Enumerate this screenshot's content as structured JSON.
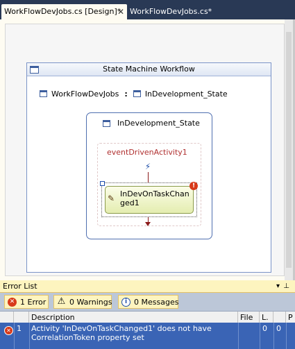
{
  "tabs": [
    {
      "label": "WorkFlowDevJobs.cs [Design]*",
      "close_glyph": "✕"
    },
    {
      "label": "WorkFlowDevJobs.cs*"
    }
  ],
  "designer": {
    "workflow_title": "State Machine Workflow",
    "breadcrumb": {
      "root": "WorkFlowDevJobs",
      "separator": ":",
      "current": "InDevelopment_State"
    },
    "state_name": "InDevelopment_State",
    "event_driven_name": "eventDrivenActivity1",
    "activity_name": "InDevOnTaskChanged1",
    "error_badge": "!"
  },
  "error_list": {
    "title": "Error List",
    "title_controls": [
      "▾",
      "⊥"
    ],
    "filters": {
      "errors": {
        "label": "1 Error",
        "icon": "✕"
      },
      "warnings": {
        "label": "0 Warnings",
        "icon": "⚠"
      },
      "messages": {
        "label": "0 Messages",
        "icon": "i"
      }
    },
    "columns": [
      "",
      "Description",
      "File",
      "L.",
      "",
      "P"
    ],
    "rows": [
      {
        "icon": "error-icon",
        "number": "1",
        "description": "Activity 'InDevOnTaskChanged1' does not have CorrelationToken property set",
        "file": "",
        "line": "0",
        "column": "0"
      }
    ]
  },
  "colors": {
    "chrome": "#293955",
    "designer_bg": "#fefcf2",
    "selection_row": "#3a64b5",
    "error_red": "#d83a1a",
    "panel_yellow": "#fdf4bf"
  }
}
